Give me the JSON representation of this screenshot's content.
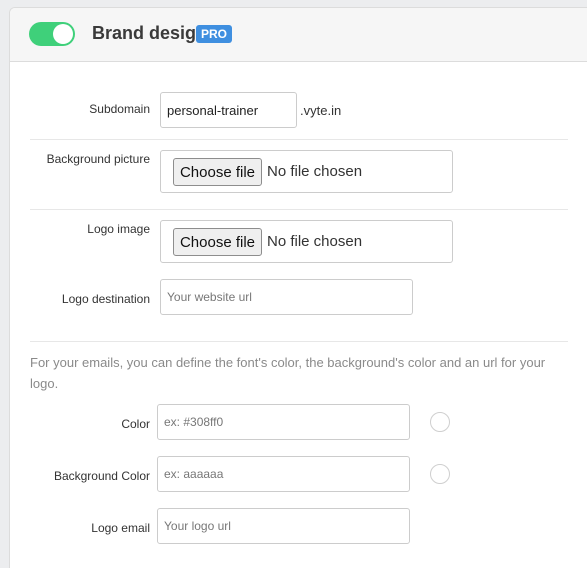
{
  "header": {
    "title": "Brand design",
    "badge": "PRO",
    "toggle_on": true,
    "toggle_color": "#3fd07a",
    "badge_color": "#3f8fe0"
  },
  "form": {
    "subdomain": {
      "label": "Subdomain",
      "value": "personal-trainer",
      "suffix": ".vyte.in"
    },
    "background_picture": {
      "label": "Background picture",
      "button": "Choose file",
      "status": "No file chosen"
    },
    "logo_image": {
      "label": "Logo image",
      "button": "Choose file",
      "status": "No file chosen"
    },
    "logo_destination": {
      "label": "Logo destination",
      "placeholder": "Your website url"
    },
    "email_info": "For your emails, you can define the font's color, the background's color and an url for your logo.",
    "color": {
      "label": "Color",
      "placeholder": "ex: #308ff0"
    },
    "background_color": {
      "label": "Background Color",
      "placeholder": "ex: aaaaaa"
    },
    "logo_email": {
      "label": "Logo email",
      "placeholder": "Your logo url"
    }
  }
}
